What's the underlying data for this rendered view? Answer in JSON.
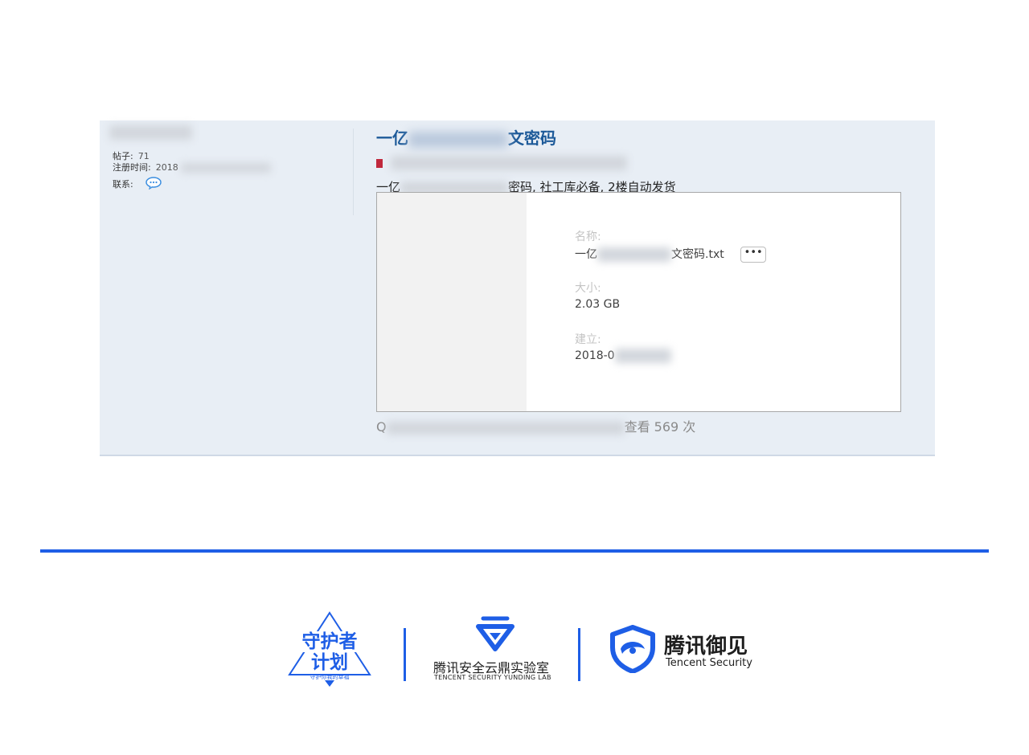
{
  "post": {
    "user": {
      "posts_label": "帖子:",
      "posts_value": "71",
      "reg_label": "注册时间:",
      "reg_value_prefix": "2018",
      "contact_label": "联系:"
    },
    "title_prefix": "一亿",
    "title_suffix": "文密码",
    "description_prefix": "一亿",
    "description_suffix": "密码, 社工库必备, 2楼自动发货",
    "properties": {
      "name_label": "名称:",
      "name_prefix": "一亿",
      "name_suffix": "文密码.txt",
      "more_button": "•••",
      "size_label": "大小:",
      "size_value": "2.03 GB",
      "created_label": "建立:",
      "created_prefix": "2018-0"
    },
    "footer": {
      "prefix": "Q",
      "views_text": "查看 569 次"
    }
  },
  "logos": {
    "guardian": {
      "line1": "守护者",
      "line2": "计划",
      "tagline": "守护你我的幸福"
    },
    "yunding": {
      "cn": "腾讯安全云鼎实验室",
      "en": "TENCENT SECURITY YUNDING LAB"
    },
    "yujian": {
      "cn": "腾讯御见",
      "en": "Tencent Security"
    }
  },
  "colors": {
    "accent": "#1e5ee6",
    "title_blue": "#1d5a99",
    "post_bg": "#e8eef5"
  }
}
